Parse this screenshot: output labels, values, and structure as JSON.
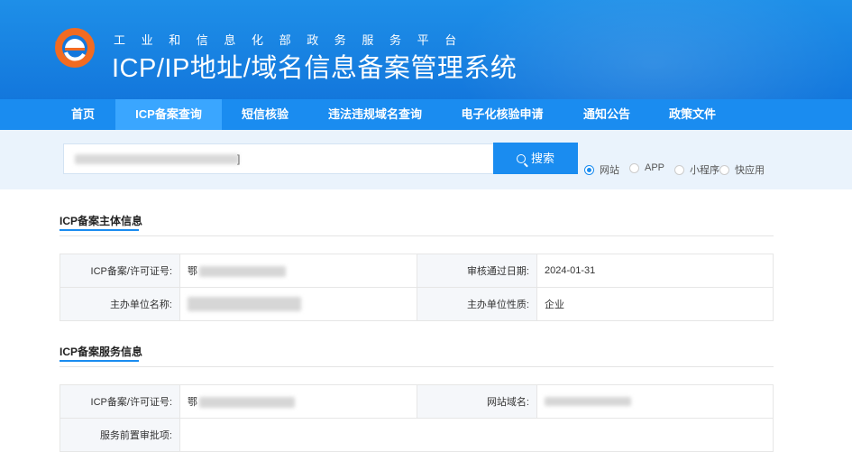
{
  "header": {
    "subtitle": "工业和信息化部政务服务平台",
    "title": "ICP/IP地址/域名信息备案管理系统",
    "logo": "e-swirl-logo"
  },
  "nav": {
    "items": [
      {
        "label": "首页",
        "active": false
      },
      {
        "label": "ICP备案查询",
        "active": true
      },
      {
        "label": "短信核验",
        "active": false
      },
      {
        "label": "违法违规域名查询",
        "active": false
      },
      {
        "label": "电子化核验申请",
        "active": false
      },
      {
        "label": "通知公告",
        "active": false
      },
      {
        "label": "政策文件",
        "active": false
      }
    ]
  },
  "search": {
    "value": "",
    "trailing_char": "]",
    "button_label": "搜索",
    "options": [
      {
        "label": "网站",
        "checked": true
      },
      {
        "label": "APP",
        "checked": false
      },
      {
        "label": "小程序",
        "checked": false
      },
      {
        "label": "快应用",
        "checked": false
      }
    ]
  },
  "entity_section": {
    "title": "ICP备案主体信息",
    "rows": [
      {
        "label1": "ICP备案/许可证号:",
        "value1": "鄂",
        "label2": "审核通过日期:",
        "value2": "2024-01-31"
      },
      {
        "label1": "主办单位名称:",
        "value1": "",
        "label2": "主办单位性质:",
        "value2": "企业"
      }
    ]
  },
  "service_section": {
    "title": "ICP备案服务信息",
    "rows": [
      {
        "label1": "ICP备案/许可证号:",
        "value1": "鄂",
        "label2": "网站域名:",
        "value2": ""
      },
      {
        "label1": "服务前置审批项:",
        "value1": ""
      }
    ]
  },
  "colors": {
    "primary": "#1a8cf0",
    "banner": "#1377dc",
    "active_nav": "#3aa6ff",
    "logo_orange": "#f26b21"
  }
}
